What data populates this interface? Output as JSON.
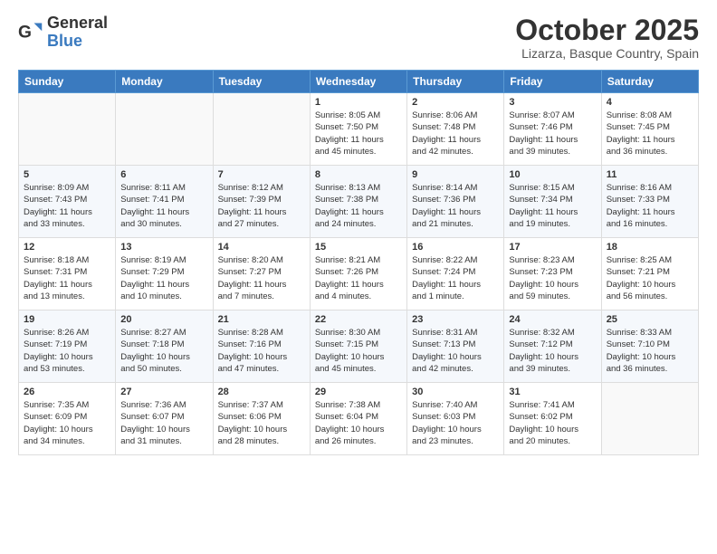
{
  "header": {
    "logo_general": "General",
    "logo_blue": "Blue",
    "month_title": "October 2025",
    "location": "Lizarza, Basque Country, Spain"
  },
  "weekdays": [
    "Sunday",
    "Monday",
    "Tuesday",
    "Wednesday",
    "Thursday",
    "Friday",
    "Saturday"
  ],
  "weeks": [
    [
      {
        "day": "",
        "info": ""
      },
      {
        "day": "",
        "info": ""
      },
      {
        "day": "",
        "info": ""
      },
      {
        "day": "1",
        "info": "Sunrise: 8:05 AM\nSunset: 7:50 PM\nDaylight: 11 hours\nand 45 minutes."
      },
      {
        "day": "2",
        "info": "Sunrise: 8:06 AM\nSunset: 7:48 PM\nDaylight: 11 hours\nand 42 minutes."
      },
      {
        "day": "3",
        "info": "Sunrise: 8:07 AM\nSunset: 7:46 PM\nDaylight: 11 hours\nand 39 minutes."
      },
      {
        "day": "4",
        "info": "Sunrise: 8:08 AM\nSunset: 7:45 PM\nDaylight: 11 hours\nand 36 minutes."
      }
    ],
    [
      {
        "day": "5",
        "info": "Sunrise: 8:09 AM\nSunset: 7:43 PM\nDaylight: 11 hours\nand 33 minutes."
      },
      {
        "day": "6",
        "info": "Sunrise: 8:11 AM\nSunset: 7:41 PM\nDaylight: 11 hours\nand 30 minutes."
      },
      {
        "day": "7",
        "info": "Sunrise: 8:12 AM\nSunset: 7:39 PM\nDaylight: 11 hours\nand 27 minutes."
      },
      {
        "day": "8",
        "info": "Sunrise: 8:13 AM\nSunset: 7:38 PM\nDaylight: 11 hours\nand 24 minutes."
      },
      {
        "day": "9",
        "info": "Sunrise: 8:14 AM\nSunset: 7:36 PM\nDaylight: 11 hours\nand 21 minutes."
      },
      {
        "day": "10",
        "info": "Sunrise: 8:15 AM\nSunset: 7:34 PM\nDaylight: 11 hours\nand 19 minutes."
      },
      {
        "day": "11",
        "info": "Sunrise: 8:16 AM\nSunset: 7:33 PM\nDaylight: 11 hours\nand 16 minutes."
      }
    ],
    [
      {
        "day": "12",
        "info": "Sunrise: 8:18 AM\nSunset: 7:31 PM\nDaylight: 11 hours\nand 13 minutes."
      },
      {
        "day": "13",
        "info": "Sunrise: 8:19 AM\nSunset: 7:29 PM\nDaylight: 11 hours\nand 10 minutes."
      },
      {
        "day": "14",
        "info": "Sunrise: 8:20 AM\nSunset: 7:27 PM\nDaylight: 11 hours\nand 7 minutes."
      },
      {
        "day": "15",
        "info": "Sunrise: 8:21 AM\nSunset: 7:26 PM\nDaylight: 11 hours\nand 4 minutes."
      },
      {
        "day": "16",
        "info": "Sunrise: 8:22 AM\nSunset: 7:24 PM\nDaylight: 11 hours\nand 1 minute."
      },
      {
        "day": "17",
        "info": "Sunrise: 8:23 AM\nSunset: 7:23 PM\nDaylight: 10 hours\nand 59 minutes."
      },
      {
        "day": "18",
        "info": "Sunrise: 8:25 AM\nSunset: 7:21 PM\nDaylight: 10 hours\nand 56 minutes."
      }
    ],
    [
      {
        "day": "19",
        "info": "Sunrise: 8:26 AM\nSunset: 7:19 PM\nDaylight: 10 hours\nand 53 minutes."
      },
      {
        "day": "20",
        "info": "Sunrise: 8:27 AM\nSunset: 7:18 PM\nDaylight: 10 hours\nand 50 minutes."
      },
      {
        "day": "21",
        "info": "Sunrise: 8:28 AM\nSunset: 7:16 PM\nDaylight: 10 hours\nand 47 minutes."
      },
      {
        "day": "22",
        "info": "Sunrise: 8:30 AM\nSunset: 7:15 PM\nDaylight: 10 hours\nand 45 minutes."
      },
      {
        "day": "23",
        "info": "Sunrise: 8:31 AM\nSunset: 7:13 PM\nDaylight: 10 hours\nand 42 minutes."
      },
      {
        "day": "24",
        "info": "Sunrise: 8:32 AM\nSunset: 7:12 PM\nDaylight: 10 hours\nand 39 minutes."
      },
      {
        "day": "25",
        "info": "Sunrise: 8:33 AM\nSunset: 7:10 PM\nDaylight: 10 hours\nand 36 minutes."
      }
    ],
    [
      {
        "day": "26",
        "info": "Sunrise: 7:35 AM\nSunset: 6:09 PM\nDaylight: 10 hours\nand 34 minutes."
      },
      {
        "day": "27",
        "info": "Sunrise: 7:36 AM\nSunset: 6:07 PM\nDaylight: 10 hours\nand 31 minutes."
      },
      {
        "day": "28",
        "info": "Sunrise: 7:37 AM\nSunset: 6:06 PM\nDaylight: 10 hours\nand 28 minutes."
      },
      {
        "day": "29",
        "info": "Sunrise: 7:38 AM\nSunset: 6:04 PM\nDaylight: 10 hours\nand 26 minutes."
      },
      {
        "day": "30",
        "info": "Sunrise: 7:40 AM\nSunset: 6:03 PM\nDaylight: 10 hours\nand 23 minutes."
      },
      {
        "day": "31",
        "info": "Sunrise: 7:41 AM\nSunset: 6:02 PM\nDaylight: 10 hours\nand 20 minutes."
      },
      {
        "day": "",
        "info": ""
      }
    ]
  ]
}
